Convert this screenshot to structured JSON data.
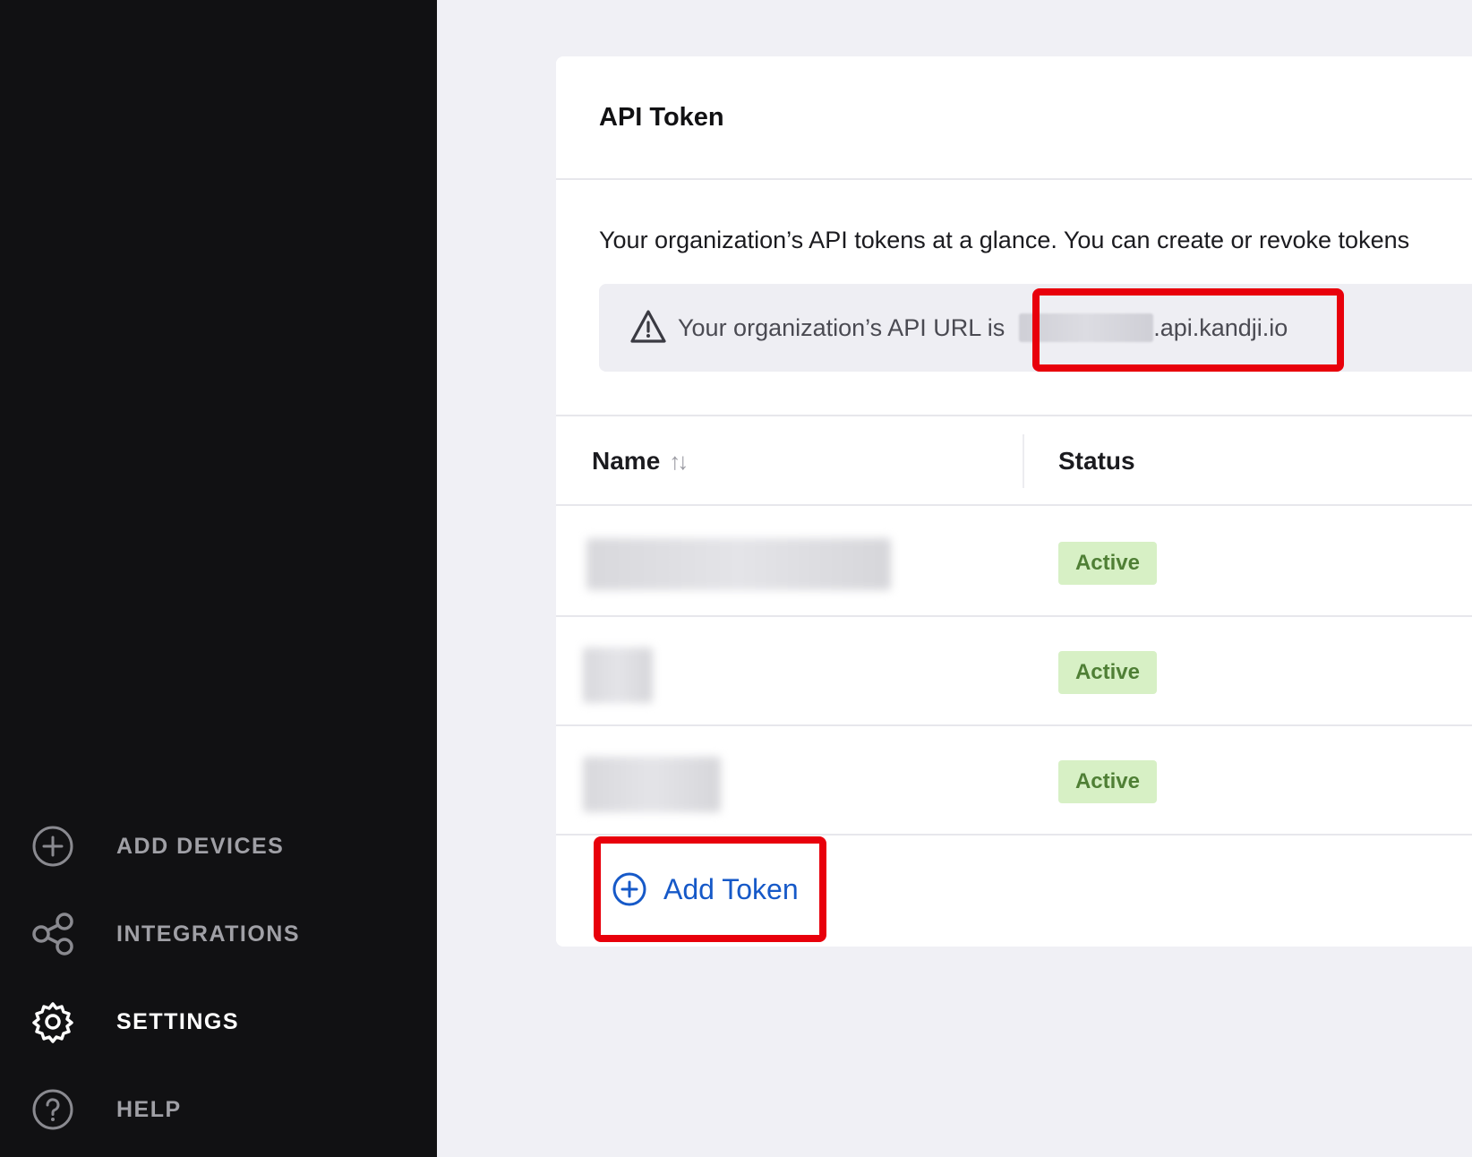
{
  "sidebar": {
    "items": [
      {
        "label": "ADD DEVICES",
        "icon": "plus-circle-icon"
      },
      {
        "label": "INTEGRATIONS",
        "icon": "share-nodes-icon"
      },
      {
        "label": "SETTINGS",
        "icon": "gear-icon",
        "active": true
      },
      {
        "label": "HELP",
        "icon": "question-circle-icon"
      }
    ]
  },
  "card": {
    "title": "API Token",
    "intro": "Your organization’s API tokens at a glance. You can create or revoke tokens",
    "alert": {
      "icon": "warning-triangle-icon",
      "prefix": "Your organization’s API URL is",
      "url_suffix": ".api.kandji.io"
    }
  },
  "table": {
    "headers": {
      "name": "Name",
      "status": "Status",
      "sort_icon": "↑↓"
    },
    "rows": [
      {
        "status": "Active"
      },
      {
        "status": "Active"
      },
      {
        "status": "Active"
      }
    ]
  },
  "add_token": {
    "label": "Add Token",
    "icon": "plus-circle-icon"
  },
  "colors": {
    "sidebar_bg": "#111113",
    "accent_blue": "#1659c8",
    "highlight_red": "#e8000b",
    "active_badge_bg": "#d7f0c5",
    "active_badge_text": "#4f7f35"
  }
}
